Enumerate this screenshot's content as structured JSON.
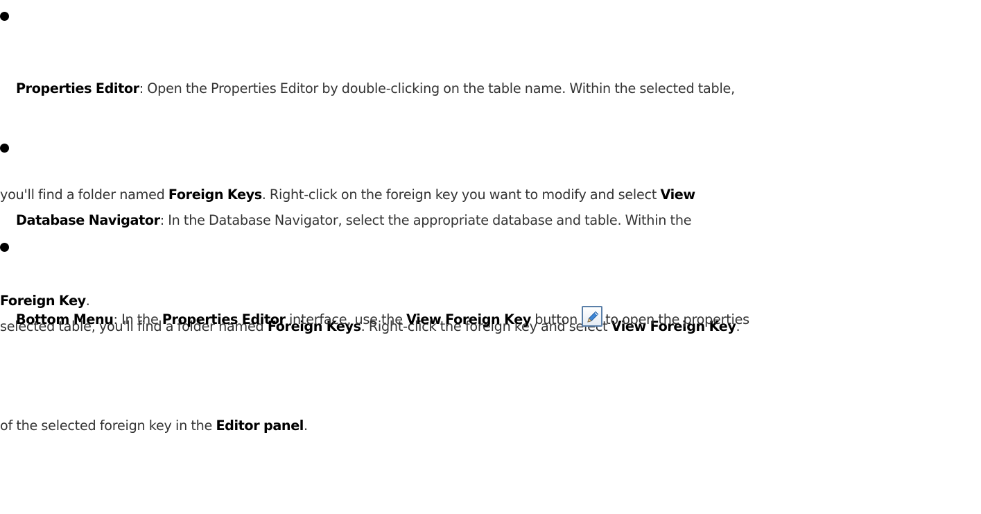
{
  "items": [
    {
      "l1_head": "Properties Editor",
      "l1_text": ": Open the Properties Editor by double-clicking on the table name. Within the selected table,",
      "l2_text_a": "you'll find a folder named ",
      "l2_bold_a": "Foreign Keys",
      "l2_text_b": ". Right-click on the foreign key you want to modify and select ",
      "l2_bold_b": "View",
      "l3_bold": "Foreign Key",
      "l3_text": "."
    },
    {
      "l1_head": "Database Navigator",
      "l1_text": ": In the Database Navigator, select the appropriate database and table. Within the",
      "l2_text_a": "selected table, you'll find a folder named ",
      "l2_bold_a": "Foreign Keys",
      "l2_text_b": ". Right-click the foreign key and select ",
      "l2_bold_b": "View Foreign Key",
      "l2_text_c": "."
    },
    {
      "l1_head": "Bottom Menu",
      "l1_text_a": ": In the ",
      "l1_bold_a": "Properties Editor",
      "l1_text_b": " interface, use the ",
      "l1_bold_b": "View Foreign Key",
      "l1_text_c": " button",
      "l1_text_d": "to open the properties",
      "l2_text_a": "of the selected foreign key in the ",
      "l2_bold_a": "Editor panel",
      "l2_text_b": "."
    }
  ],
  "icons": {
    "edit_button_icon": "pencil-icon"
  }
}
